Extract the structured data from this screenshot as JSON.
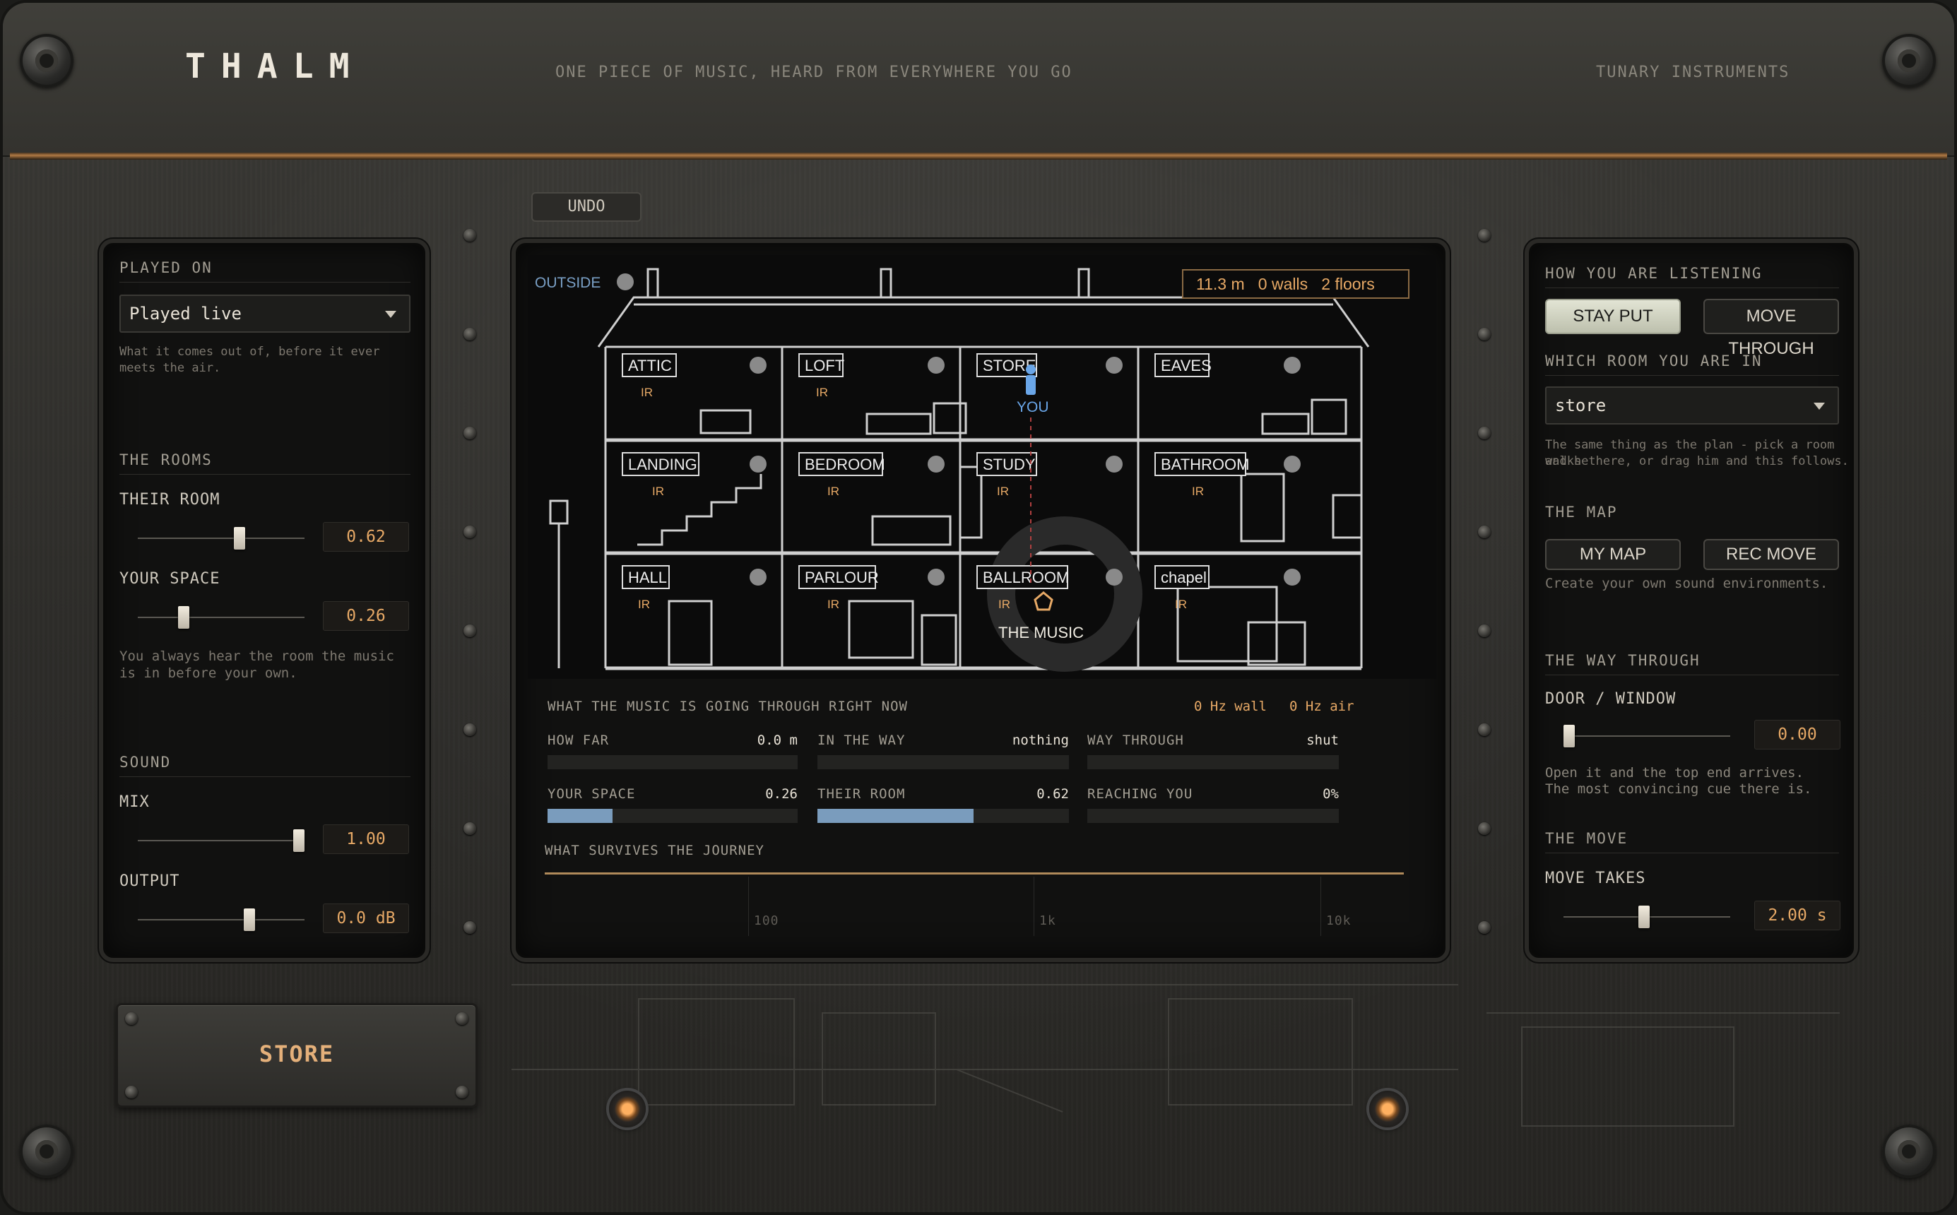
{
  "header": {
    "logo": "THALM",
    "tagline": "ONE PIECE OF MUSIC, HEARD FROM EVERYWHERE YOU GO",
    "maker": "TUNARY INSTRUMENTS"
  },
  "toolbar": {
    "undo_label": "UNDO"
  },
  "left": {
    "played_on_label": "PLAYED ON",
    "played_on_value": "Played live",
    "played_on_hint": "What it comes out of, before it ever meets the air.",
    "rooms_label": "THE ROOMS",
    "their_room": {
      "label": "THEIR ROOM",
      "value": "0.62",
      "level": 0.62
    },
    "your_space": {
      "label": "YOUR SPACE",
      "value": "0.26",
      "level": 0.26
    },
    "rooms_hint": "You always hear the room the music is in before your own.",
    "sound_label": "SOUND",
    "mix": {
      "label": "MIX",
      "value": "1.00",
      "level": 1.0
    },
    "output": {
      "label": "OUTPUT",
      "value": "0.0 dB",
      "level": 0.68
    }
  },
  "store_label": "STORE",
  "house": {
    "outside_label": "OUTSIDE",
    "distance": "11.3 m",
    "walls": "0 walls",
    "floors": "2 floors",
    "you_label": "YOU",
    "music_label": "THE MUSIC",
    "ir_label": "IR",
    "rooms": [
      "ATTIC",
      "LOFT",
      "STORE",
      "EAVES",
      "LANDING",
      "BEDROOM",
      "STUDY",
      "BATHROOM",
      "HALL",
      "PARLOUR",
      "BALLROOM",
      "chapel"
    ]
  },
  "journey": {
    "title": "WHAT THE MUSIC IS GOING THROUGH RIGHT NOW",
    "wall_hz": "0 Hz wall",
    "air_hz": "0 Hz air",
    "how_far": {
      "label": "HOW FAR",
      "value": "0.0 m"
    },
    "in_the_way": {
      "label": "IN THE WAY",
      "value": "nothing"
    },
    "way_through": {
      "label": "WAY THROUGH",
      "value": "shut"
    },
    "your_space": {
      "label": "YOUR SPACE",
      "value": "0.26",
      "level": 0.26
    },
    "their_room": {
      "label": "THEIR ROOM",
      "value": "0.62",
      "level": 0.62
    },
    "reaching_you": {
      "label": "REACHING YOU",
      "value": "0%",
      "level": 0
    },
    "survives_title": "WHAT SURVIVES THE JOURNEY",
    "freq_ticks": [
      "100",
      "1k",
      "10k"
    ]
  },
  "right": {
    "listening_label": "HOW YOU ARE LISTENING",
    "stay_put": "STAY PUT",
    "move_through": "MOVE THROUGH",
    "which_room_label": "WHICH ROOM YOU ARE IN",
    "room_value": "store",
    "room_hint_1": "The same thing as the plan - pick a room and he",
    "room_hint_2": "walks there, or drag him and this follows.",
    "map_label": "THE MAP",
    "my_map": "MY MAP",
    "rec_move": "REC MOVE",
    "map_hint": "Create your own sound environments.",
    "way_through_label": "THE WAY THROUGH",
    "door": {
      "label": "DOOR / WINDOW",
      "value": "0.00",
      "level": 0.0
    },
    "door_hint_1": "Open it and the top end arrives.",
    "door_hint_2": "The most convincing cue there is.",
    "move_label": "THE MOVE",
    "move_takes": {
      "label": "MOVE TAKES",
      "value": "2.00 s",
      "level": 0.48
    }
  },
  "colors": {
    "accent": "#e7a966",
    "blue": "#7a9cbd",
    "copper": "#b07a45"
  }
}
